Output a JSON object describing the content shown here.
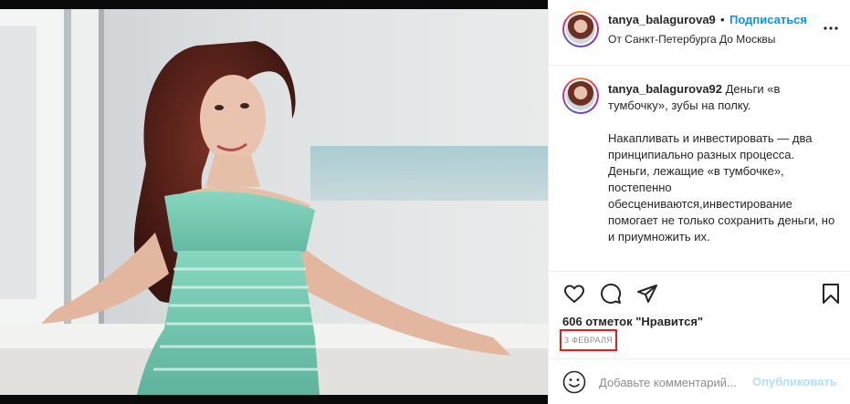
{
  "post": {
    "username": "tanya_balagurova9",
    "follow_label": "Подписаться",
    "dot": "•",
    "location": "От Санкт-Петербурга До Москвы",
    "more_icon": "more-horizontal-icon",
    "caption": {
      "username": "tanya_balagurova92",
      "text": " Деньги «в тумбочку», зубы на полку.\n\nНакапливать и инвестировать — два принципиально разных процесса. Деньги, лежащие «в тумбочке», постепенно обесцениваются,инвестирование помогает не только сохранить деньги, но и приумножить их."
    },
    "likes_text": "606 отметок \"Нравится\"",
    "date": "3 февраля",
    "comment_placeholder": "Добавьте комментарий...",
    "publish_label": "Опубликовать",
    "icons": [
      "heart-icon",
      "comment-icon",
      "share-icon",
      "bookmark-icon",
      "emoji-icon"
    ],
    "colors": {
      "accent": "#0095f6",
      "publish_disabled": "#b2dffc",
      "date_highlight": "#e0211f",
      "dress": "#7fcfb8"
    }
  }
}
